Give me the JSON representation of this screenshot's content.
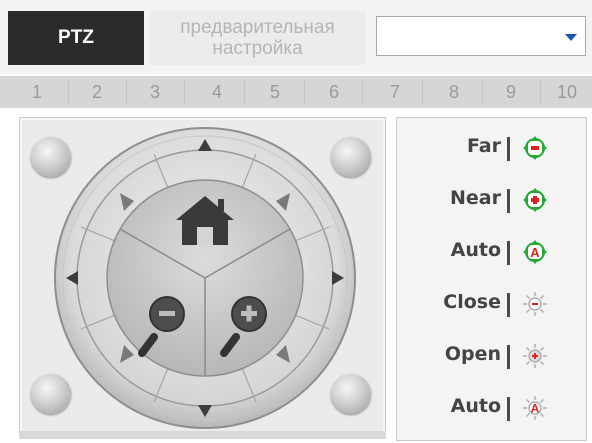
{
  "tabs": {
    "ptz_label": "PTZ",
    "preset_label_line1": "предварительная",
    "preset_label_line2": "настройка"
  },
  "preset_select": {
    "value": ""
  },
  "numbers": [
    "1",
    "2",
    "3",
    "4",
    "5",
    "6",
    "7",
    "8",
    "9",
    "10"
  ],
  "lens_controls": {
    "far_label": "Far",
    "near_label": "Near",
    "auto_focus_label": "Auto",
    "close_label": "Close",
    "open_label": "Open",
    "auto_iris_label": "Auto"
  },
  "icons": {
    "home": "home-icon",
    "zoom_out": "zoom-out-icon",
    "zoom_in": "zoom-in-icon",
    "focus_far": "focus-far-icon",
    "focus_near": "focus-near-icon",
    "focus_auto": "focus-auto-icon",
    "iris_close": "iris-close-icon",
    "iris_open": "iris-open-icon",
    "iris_auto": "iris-auto-icon"
  },
  "colors": {
    "active_tab": "#2b2b2b",
    "accent_green": "#22aa33",
    "accent_red": "#e02020",
    "select_arrow": "#1a56b0"
  }
}
